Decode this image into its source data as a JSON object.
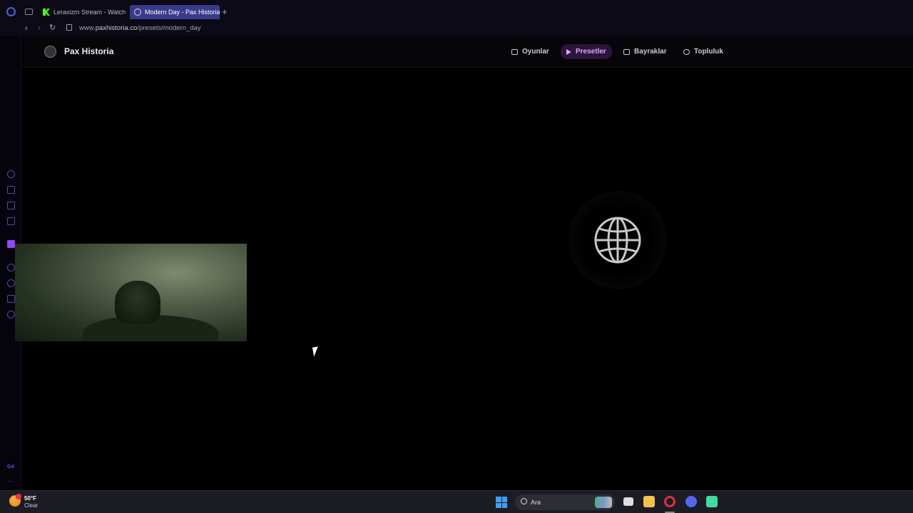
{
  "browser": {
    "tabs": [
      {
        "title": "Leraxizm Stream - Watch",
        "active": false,
        "favicon": "kick-icon"
      },
      {
        "title": "Modern Day - Pax Historia",
        "active": true,
        "favicon": "globe-icon"
      }
    ],
    "new_tab_label": "+",
    "url_prefix": "www.",
    "url_domain": "paxhistoria.co",
    "url_path": "/presets/modern_day",
    "sidebar_label": "GX",
    "sidebar_more": "..."
  },
  "site": {
    "brand": "Pax Historia",
    "nav": [
      {
        "label": "Oyunlar",
        "icon": "gamepad-icon",
        "active": false
      },
      {
        "label": "Presetler",
        "icon": "play-icon",
        "active": true
      },
      {
        "label": "Bayraklar",
        "icon": "flag-icon",
        "active": false
      },
      {
        "label": "Topluluk",
        "icon": "users-icon",
        "active": false
      }
    ],
    "accent_color": "#e0a4ff"
  },
  "taskbar": {
    "temperature": "50°F",
    "condition": "Clear",
    "search_placeholder": "Ara"
  }
}
